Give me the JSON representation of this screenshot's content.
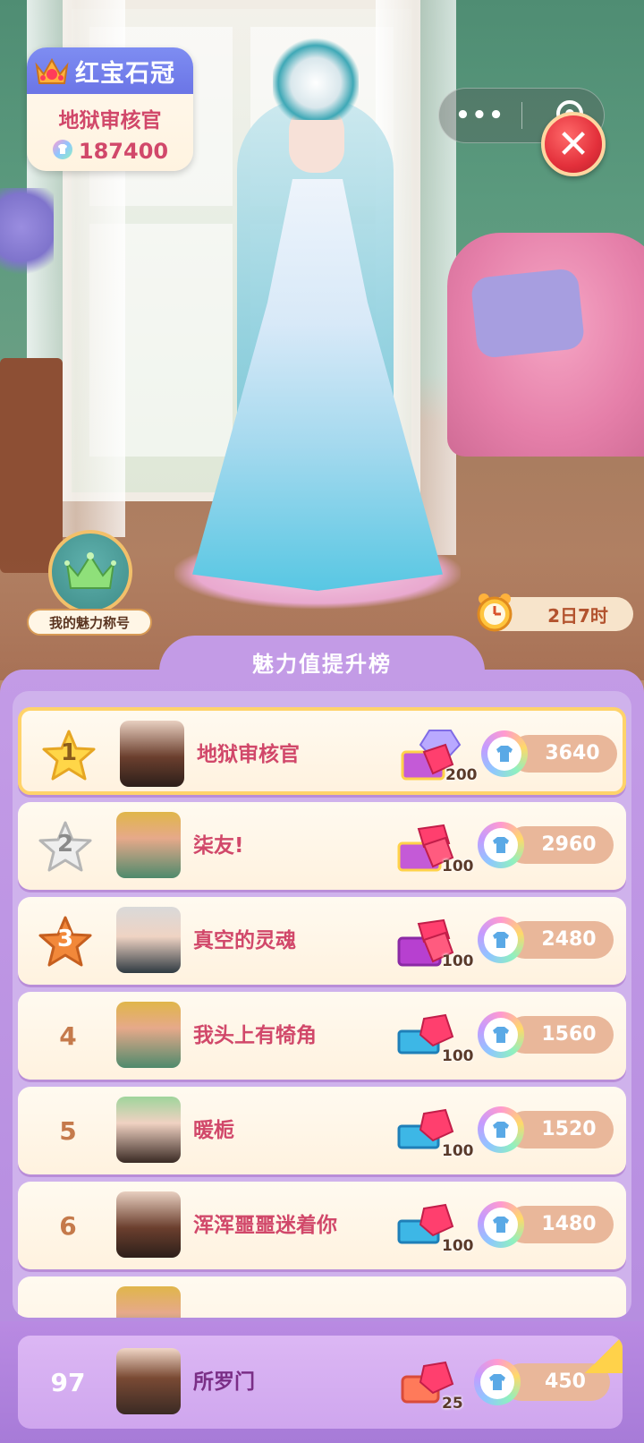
{
  "header": {
    "rank_badge_title": "红宝石冠",
    "player_name": "地狱审核官",
    "charm_score": "187400"
  },
  "capsule": {
    "more_label": "•••",
    "close_label": "✕"
  },
  "charm_title_button": {
    "label": "我的魅力称号"
  },
  "timer": {
    "remaining": "2日7时"
  },
  "board": {
    "title": "魅力值提升榜",
    "rows": [
      {
        "rank": "1",
        "name": "地狱审核官",
        "gift_count": "200",
        "score": "3640"
      },
      {
        "rank": "2",
        "name": "柒友!",
        "gift_count": "100",
        "score": "2960"
      },
      {
        "rank": "3",
        "name": "真空的灵魂",
        "gift_count": "100",
        "score": "2480"
      },
      {
        "rank": "4",
        "name": "我头上有犄角",
        "gift_count": "100",
        "score": "1560"
      },
      {
        "rank": "5",
        "name": "暖栀",
        "gift_count": "100",
        "score": "1520"
      },
      {
        "rank": "6",
        "name": "浑浑噩噩迷着你",
        "gift_count": "100",
        "score": "1480"
      }
    ]
  },
  "my_rank": {
    "rank": "97",
    "name": "所罗门",
    "gift_count": "25",
    "score": "450"
  },
  "colors": {
    "accent_pink": "#d1486a",
    "board_purple": "#c39be6",
    "gold": "#ffd36a"
  }
}
